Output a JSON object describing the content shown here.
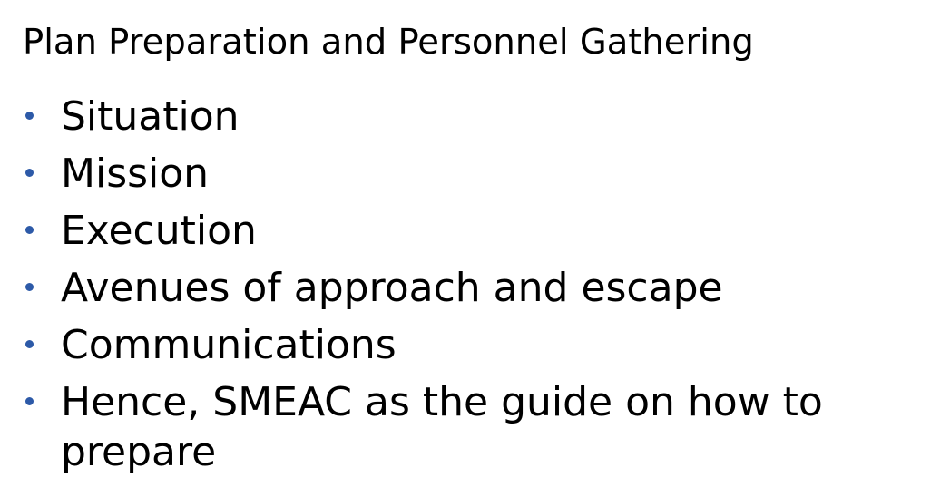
{
  "slide": {
    "title": "Plan Preparation and Personnel Gathering",
    "bullet_color": "#2d5aa8",
    "items": [
      {
        "label": "Situation"
      },
      {
        "label": "Mission"
      },
      {
        "label": "Execution"
      },
      {
        "label": "Avenues of approach and escape"
      },
      {
        "label": "Communications"
      },
      {
        "label": "Hence, SMEAC as the guide on how to prepare"
      }
    ]
  }
}
